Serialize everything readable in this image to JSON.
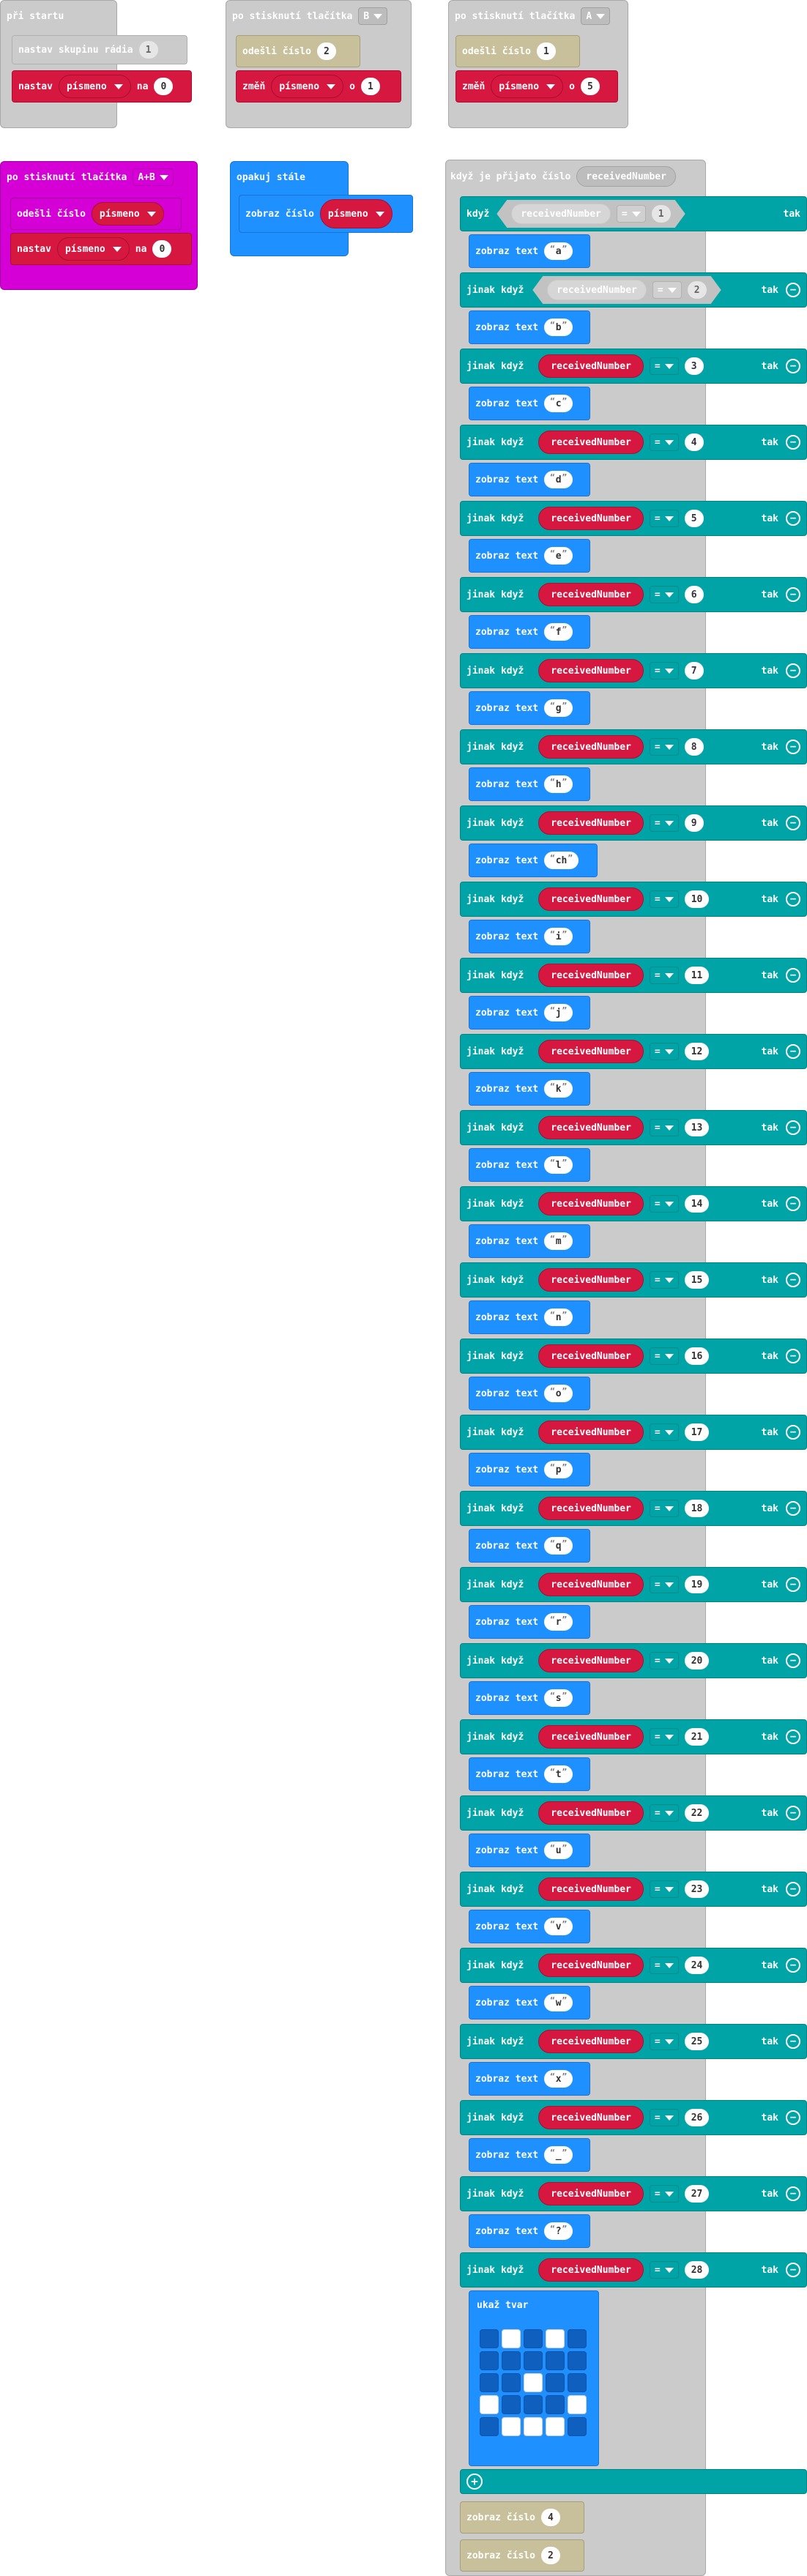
{
  "on_start": {
    "title": "při startu",
    "set_group_label": "nastav skupinu rádia",
    "set_group_value": "1",
    "set_label": "nastav",
    "var_name": "písmeno",
    "to_label": "na",
    "set_value": "0"
  },
  "button_b": {
    "title": "po stisknutí tlačítka",
    "button_value": "B",
    "send_label": "odešli číslo",
    "send_value": "2",
    "change_label": "změň",
    "var_name": "písmeno",
    "by_label": "o",
    "change_value": "1"
  },
  "button_a": {
    "title": "po stisknutí tlačítka",
    "button_value": "A",
    "send_label": "odešli číslo",
    "send_value": "1",
    "change_label": "změň",
    "var_name": "písmeno",
    "by_label": "o",
    "change_value": "5"
  },
  "button_ab": {
    "title": "po stisknutí tlačítka",
    "button_value": "A+B",
    "send_label": "odešli číslo",
    "var_name": "písmeno",
    "set_label": "nastav",
    "to_label": "na",
    "set_value": "0"
  },
  "forever": {
    "title": "opakuj stále",
    "show_number_label": "zobraz číslo",
    "var_name": "písmeno"
  },
  "radio_received": {
    "title": "když je přijato číslo",
    "param": "receivedNumber",
    "if_label": "když",
    "elseif_label": "jinak když",
    "then_label": "tak",
    "op": "=",
    "show_text_label": "zobraz text",
    "cases": [
      {
        "n": "1",
        "text": "a"
      },
      {
        "n": "2",
        "text": "b"
      },
      {
        "n": "3",
        "text": "c"
      },
      {
        "n": "4",
        "text": "d"
      },
      {
        "n": "5",
        "text": "e"
      },
      {
        "n": "6",
        "text": "f"
      },
      {
        "n": "7",
        "text": "g"
      },
      {
        "n": "8",
        "text": "h"
      },
      {
        "n": "9",
        "text": "ch"
      },
      {
        "n": "10",
        "text": "i"
      },
      {
        "n": "11",
        "text": "j"
      },
      {
        "n": "12",
        "text": "k"
      },
      {
        "n": "13",
        "text": "l"
      },
      {
        "n": "14",
        "text": "m"
      },
      {
        "n": "15",
        "text": "n"
      },
      {
        "n": "16",
        "text": "o"
      },
      {
        "n": "17",
        "text": "p"
      },
      {
        "n": "18",
        "text": "q"
      },
      {
        "n": "19",
        "text": "r"
      },
      {
        "n": "20",
        "text": "s"
      },
      {
        "n": "21",
        "text": "t"
      },
      {
        "n": "22",
        "text": "u"
      },
      {
        "n": "23",
        "text": "v"
      },
      {
        "n": "24",
        "text": "w"
      },
      {
        "n": "25",
        "text": "x"
      },
      {
        "n": "26",
        "text": "_"
      },
      {
        "n": "27",
        "text": "?"
      },
      {
        "n": "28",
        "text": ""
      }
    ],
    "show_leds_label": "ukaž tvar",
    "leds": [
      [
        0,
        1,
        0,
        1,
        0
      ],
      [
        0,
        0,
        0,
        0,
        0
      ],
      [
        0,
        0,
        1,
        0,
        0
      ],
      [
        1,
        0,
        0,
        0,
        1
      ],
      [
        0,
        1,
        1,
        1,
        0
      ]
    ],
    "show_number_label": "zobraz číslo",
    "tail_values": [
      "4",
      "2"
    ]
  }
}
